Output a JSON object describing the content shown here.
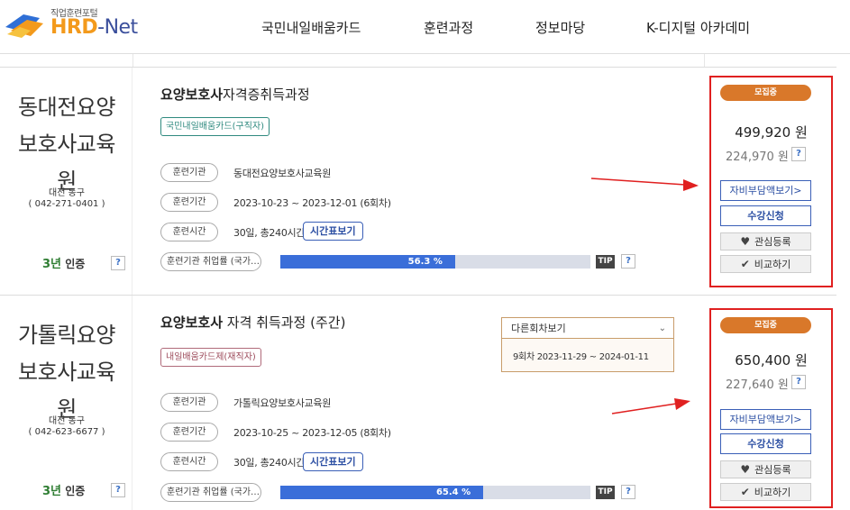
{
  "header": {
    "logo_sub": "직업훈련포털",
    "logo_hrd": "HRD",
    "logo_net": "-Net",
    "nav": [
      "국민내일배움카드",
      "훈련과정",
      "정보마당",
      "K-디지털 아카데미"
    ]
  },
  "courses": [
    {
      "institution_lines": [
        "동대전요양",
        "보호사교육",
        "원"
      ],
      "region": "대전 동구",
      "phone": "( 042-271-0401 )",
      "cert_num": "3년",
      "cert_label": "인증",
      "title_bold": "요양보호사",
      "title_rest": "자격증취득과정",
      "card_type": "국민내일배움카드(구직자)",
      "rows": [
        {
          "label": "훈련기관",
          "value": "동대전요양보호사교육원"
        },
        {
          "label": "훈련기간",
          "value": "2023-10-23 ~ 2023-12-01 (6회차)"
        },
        {
          "label": "훈련시간",
          "value": "30일, 총240시간"
        }
      ],
      "time_button": "시간표보기",
      "employment_label": "훈련기관 취업률 (국가…",
      "employment_rate": 56.3,
      "employment_text": "56.3 %",
      "tip": "TIP",
      "status": "모집중",
      "price": "499,920 원",
      "self_pay": "224,970 원",
      "btn_cost": "자비부담액보기>",
      "btn_apply": "수강신청",
      "btn_fav": "관심등록",
      "btn_compare": "비교하기"
    },
    {
      "institution_lines": [
        "가톨릭요양",
        "보호사교육",
        "원"
      ],
      "region": "대전 동구",
      "phone": "( 042-623-6677 )",
      "cert_num": "3년",
      "cert_label": "인증",
      "title_bold": "요양보호사",
      "title_rest": " 자격 취득과정 (주간)",
      "card_type": "내일배움카드제(재직자)",
      "session_head": "다른회차보기",
      "session_item": "9회차 2023-11-29 ~ 2024-01-11",
      "rows": [
        {
          "label": "훈련기관",
          "value": "가톨릭요양보호사교육원"
        },
        {
          "label": "훈련기간",
          "value": "2023-10-25 ~ 2023-12-05 (8회차)"
        },
        {
          "label": "훈련시간",
          "value": "30일, 총240시간"
        }
      ],
      "time_button": "시간표보기",
      "employment_label": "훈련기관 취업률 (국가…",
      "employment_rate": 65.4,
      "employment_text": "65.4 %",
      "tip": "TIP",
      "status": "모집중",
      "price": "650,400 원",
      "self_pay": "227,640 원",
      "btn_cost": "자비부담액보기>",
      "btn_apply": "수강신청",
      "btn_fav": "관심등록",
      "btn_compare": "비교하기"
    }
  ],
  "help_mark": "?",
  "colors": {
    "accent_blue": "#3a6ed9",
    "recruit_orange": "#d9782a",
    "highlight_red": "#e02020"
  }
}
